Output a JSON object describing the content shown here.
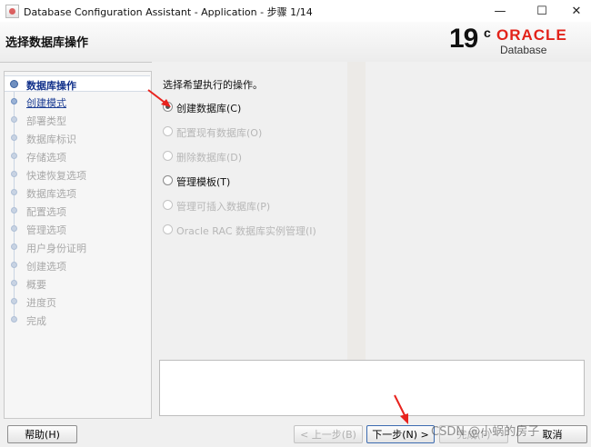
{
  "window": {
    "title": "Database Configuration Assistant - Application - 步骤 1/14",
    "controls": {
      "minimize": "—",
      "maximize": "☐",
      "close": "✕"
    }
  },
  "header": {
    "page_title": "选择数据库操作",
    "logo": {
      "version": "19",
      "superscript": "c",
      "brand": "ORACLE",
      "product": "Database",
      "brand_color": "#e2231a"
    }
  },
  "nav": {
    "items": [
      {
        "label": "数据库操作",
        "state": "current"
      },
      {
        "label": "创建模式",
        "state": "next"
      },
      {
        "label": "部署类型",
        "state": "disabled"
      },
      {
        "label": "数据库标识",
        "state": "disabled"
      },
      {
        "label": "存储选项",
        "state": "disabled"
      },
      {
        "label": "快速恢复选项",
        "state": "disabled"
      },
      {
        "label": "数据库选项",
        "state": "disabled"
      },
      {
        "label": "配置选项",
        "state": "disabled"
      },
      {
        "label": "管理选项",
        "state": "disabled"
      },
      {
        "label": "用户身份证明",
        "state": "disabled"
      },
      {
        "label": "创建选项",
        "state": "disabled"
      },
      {
        "label": "概要",
        "state": "disabled"
      },
      {
        "label": "进度页",
        "state": "disabled"
      },
      {
        "label": "完成",
        "state": "disabled"
      }
    ]
  },
  "main": {
    "prompt": "选择希望执行的操作。",
    "options": [
      {
        "label": "创建数据库(C)",
        "checked": true,
        "enabled": true
      },
      {
        "label": "配置现有数据库(O)",
        "checked": false,
        "enabled": false
      },
      {
        "label": "删除数据库(D)",
        "checked": false,
        "enabled": false
      },
      {
        "label": "管理模板(T)",
        "checked": false,
        "enabled": true
      },
      {
        "label": "管理可插入数据库(P)",
        "checked": false,
        "enabled": false
      },
      {
        "label": "Oracle RAC 数据库实例管理(I)",
        "checked": false,
        "enabled": false
      }
    ]
  },
  "buttons": {
    "help": "帮助(H)",
    "back": "< 上一步(B)",
    "next": "下一步(N) >",
    "finish": "完成(F)",
    "cancel": "取消"
  },
  "watermark": "CSDN @小蜗的房子",
  "colors": {
    "annotation_arrow": "#e8231e",
    "nav_current": "#11308a"
  }
}
